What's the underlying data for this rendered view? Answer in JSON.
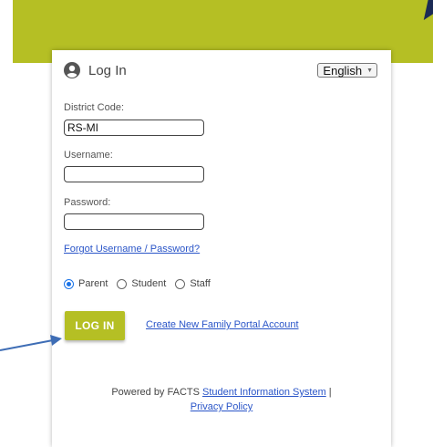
{
  "header": {
    "title": "Log In",
    "language": "English"
  },
  "form": {
    "district_code_label": "District Code:",
    "district_code_value": "RS-MI",
    "username_label": "Username:",
    "username_value": "",
    "password_label": "Password:",
    "password_value": "",
    "forgot_link": "Forgot Username / Password?",
    "roles": [
      {
        "label": "Parent",
        "selected": true
      },
      {
        "label": "Student",
        "selected": false
      },
      {
        "label": "Staff",
        "selected": false
      }
    ],
    "login_button": "LOG IN",
    "create_account_link": "Create New Family Portal Account"
  },
  "footer": {
    "powered_by": "Powered by FACTS",
    "sis_link": "Student Information System",
    "separator": "|",
    "privacy_link": "Privacy Policy"
  },
  "colors": {
    "brand": "#b5bf24",
    "link": "#2a55c8",
    "radio_accent": "#1a73e8",
    "annotation_arrow": "#3e6db5"
  },
  "icons": {
    "user": "user-circle-icon",
    "dropdown": "caret-down-icon",
    "annotation": "arrow-icon"
  }
}
